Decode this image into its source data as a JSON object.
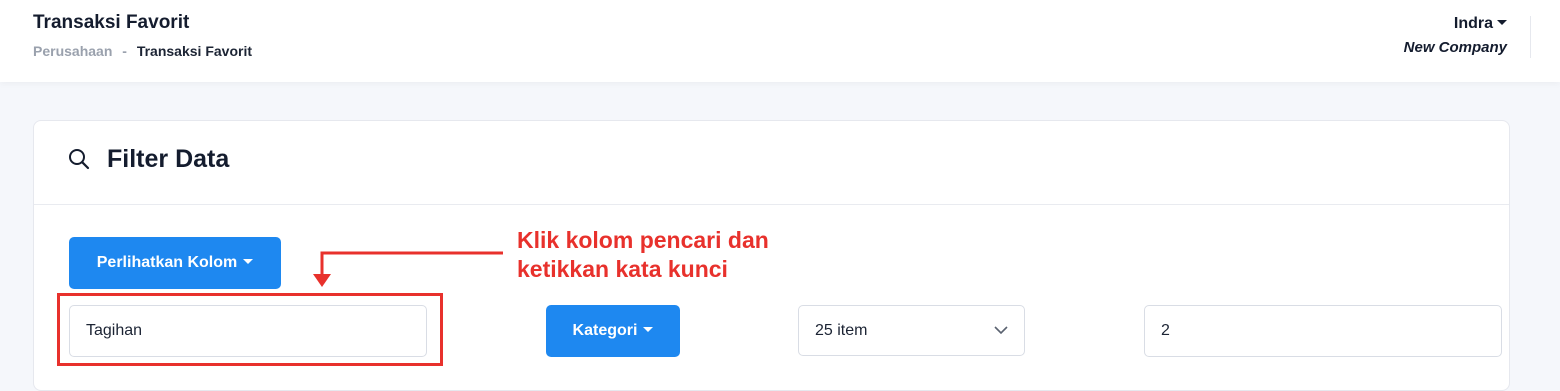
{
  "header": {
    "title": "Transaksi Favorit",
    "breadcrumb": {
      "parent": "Perusahaan",
      "separator": "-",
      "current": "Transaksi Favorit"
    },
    "user": {
      "name": "Indra",
      "company": "New Company"
    }
  },
  "filter": {
    "title": "Filter Data",
    "columns_button": "Perlihatkan Kolom",
    "search_value": "Tagihan",
    "category_button": "Kategori",
    "items_per_page": "25 item",
    "page_value": "2"
  },
  "annotation": {
    "line1": "Klik kolom pencari dan",
    "line2": "ketikkan kata kunci"
  },
  "colors": {
    "primary": "#1e88f0",
    "annotation": "#e8312c"
  },
  "icons": {
    "search": "search-icon",
    "dropdown": "chevron-down-icon",
    "caret": "caret-down-icon"
  }
}
